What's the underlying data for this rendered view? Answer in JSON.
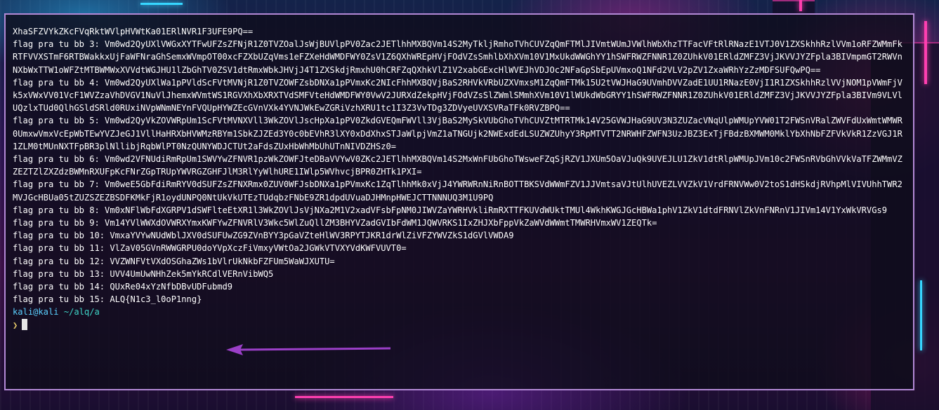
{
  "terminal": {
    "lines": [
      "XhaSFZVYkZKcFVqRktWVlpHVWtKa01ERlNVR1F3UFE9PQ==",
      "flag pra tu bb 3: Vm0wd2QyUXlVWGxXYTFwUFZsZFNjR1Z0TVZOalJsWjBUVlpPV0Zac2JETlhhMXBQVm14S2MyTkljRmhoTVhCUVZqQmFTMlJIVmtWUmJVWlhWbXhzTTFacVFtRlRNazE1VTJ0V1ZXSkhhRzlVVm1oRFZWMmFkRTFVVXSTmF6RTBWakkxUjFaWFNraGhSemxWVmpOT00xcFZXbUZqVms1eFZXeHdWMDFWY0ZsV1Z6QXhWREpHVjFOdVZsSmhlbXhXVm10V1MxUkdWWGhYY1hSWFRWZFNNR1Z0ZUhkV01ERldZMFZ3VjJKVVJYZFpla3BIVmpmGT2RWVnNXbWxTTW1oWFZtMTBWMWxXVVdtWGJHU1lZbGhTV0ZSV1dtRmxWbkJHVjJ4T1ZXSkdjRmxhU0hCRFZqQXhkVlZ1V2xabGExcHlWVEJhVDJOc2NFaGpSbEpUVmxoQ1NFd2VLV2pZV1ZxaWRhYzZzMDFSUFQwPQ==",
      "flag pra tu bb 4: Vm0wd2QyUXlWa1pPVldScFVtMVNjR1Z0TVZOWFZsbDNXa1pPVmxKc2NIcFhhMXBQVjBaS2RHVkVRbUZXVmxsM1ZqQmFTMk15U2tVWJHaG9UVmhDVVZadE1UU1RNazE0VjI1R1ZXSkhhRzlVVjNOM1pVWmFjVk5xVWxVV01VcF1WVZzaVhDVGV1NuVlJhemxWVmtWS1RGVXhXbXRXTVdSMFVteHdWMDFWY0VwV2JURXdZekpHVjFOdVZsSlZWmlSMmhXVm10V1lWUkdWbGRYY1hSWFRWZFNNR1Z0ZUhkV01ERldZMFZ3VjJKVVJYZFpla3BIVm9VLVlUQzlxTUd0QlhGSldSRld0RUxiNVpWNmNEYnFVQUpHYWZEcGVnVXk4YVNJWkEwZGRiVzhXRU1tc1I3Z3VvTDg3ZDVyeUVXSVRaTFk0RVZBPQ==",
      "flag pra tu bb 5: Vm0wd2QyVkZOVWRpUm1ScFVtMVNXVll3WkZOVlJscHpXa1pPV0ZkdGVEQmFWVll3VjBaS2MySkVUbGhoTVhCUVZtMTRTMk14V25GVWJHaG9UV3N3ZUZacVNqUlpWMUpYVW01T2FWSnVRalZWVFdUxWmtWMWR0UmxwVmxVcEpWbTEwYVZJeGJ1VllHaHRXbHVWMzRBYm1SbkZJZEd3Y0c0bEVhR3lXY0xDdXhxSTJaWlpjVmZ1aTNGUjk2NWExdEdLSUZWZUhyY3RpMTVTT2NRWHFZWFN3UzJBZ3ExTjFBdzBXMWM0MklYbXhNbFZFVkVkR1ZzVGJ1R1ZLM0tMUnNXTFpBR3plNllibjRqbWlPT0NzQUNYWDJCTUt2aFdsZUxHbWhMbUhUTnNIVDZHSz0=",
      "flag pra tu bb 6: Vm0wd2VFNUdiRmRpUm1SWVYwZFNVR1pzWkZOWFJteDBaVVYwV0ZKc2JETlhhMXBQVm14S2MxWnFUbGhoTWsweFZqSjRZV1JXUm5OaVJuQk9UVEJLU1ZkV1dtRlpWMUpJVm10c2FWSnRVbGhVVkVaTFZWMmVZZEZTZlZXZdzBWMnRXUFpKcFNrZGpTRUpYWVRGZGHFJlM3RlYyWlhURE1IWlp5WVhvcjBPR0ZHTk1PXI=",
      "flag pra tu bb 7: Vm0weE5GbFdiRmRYV0dSUFZsZFNXRmx0ZUV0WFJsbDNXa1pPVmxKc1ZqTlhhMk0xVjJ4YWRWRnNiRnBOTTBKSVdWWmFZV1JJVmtsaVJtUlhUVEZLVVZkV1VrdFRNVWw0V2toS1dHSkdjRVhpMlVIVUhhTWR2MVJGcHBUa05tZUZSZEZBSDFKMkFjR1oydUNPQ0NtUkVkUTEzTUdqbzFNbE9ZR1dpdUVuaDJHMnpHWEJCTTNNNUQ3M1U9PQ",
      "flag pra tu bb 8: Vm0xNFlWbFdXGRPV1dSWFlteEtXR1l3WkZOVlJsVjNXa2M1V2xadVFsbFpNM0JIWVZaYWRHVkliRmRXTTFKUVdWUktTMUl4WkhKWGJGcHBWa1phV1ZkV1dtdFRNVlZkVnFNRnV1JIVm14V1YxWkVRVGs9",
      "flag pra tu bb 9: Vm14YVlWWXdOVWRXYmxKWFYwZFNVRlV3Wkc5WlZuQllZM3BHYVZadGVIbFdWM1JQWVRKS1IxZHJXbFppVkZaWVdWWmtTMWRHVmxWV1ZEQTk=",
      "flag pra tu bb 10: VmxaYVYwNUdWblJXV0dSUFUwZG9ZVnBYY3pGaVZteHlWV3RPYTJKR1drWlZiVFZYWVZkS1dGVlVWDA9",
      "flag pra tu bb 11: VlZaV05GVnRWWGRPU0doYVpXczFiVmxyVWtOa2JGWkVTVXYVdKWFVUVT0=",
      "flag pra tu bb 12: VVZWNFVtVXdOSGhaZWs1bVlrUkNkbFZFUm5WaWJXUTU=",
      "flag pra tu bb 13: UVV4UmUwNHhZek5mYkRCdlVERnVibWQ5",
      "flag pra tu bb 14: QUxRe04xYzNfbDBvUDFubmd9",
      "flag pra tu bb 15: ALQ{N1c3_l0oP1nng}"
    ],
    "prompt": {
      "user": "kali",
      "at": "@",
      "host": "kali",
      "path": "~/alq/a",
      "symbol": "❯"
    }
  },
  "colors": {
    "border": "#b389d6",
    "arrow": "#9b3fc8",
    "text": "#ffffff",
    "prompt_user": "#5ad0ff",
    "prompt_path": "#3fd6c8"
  }
}
